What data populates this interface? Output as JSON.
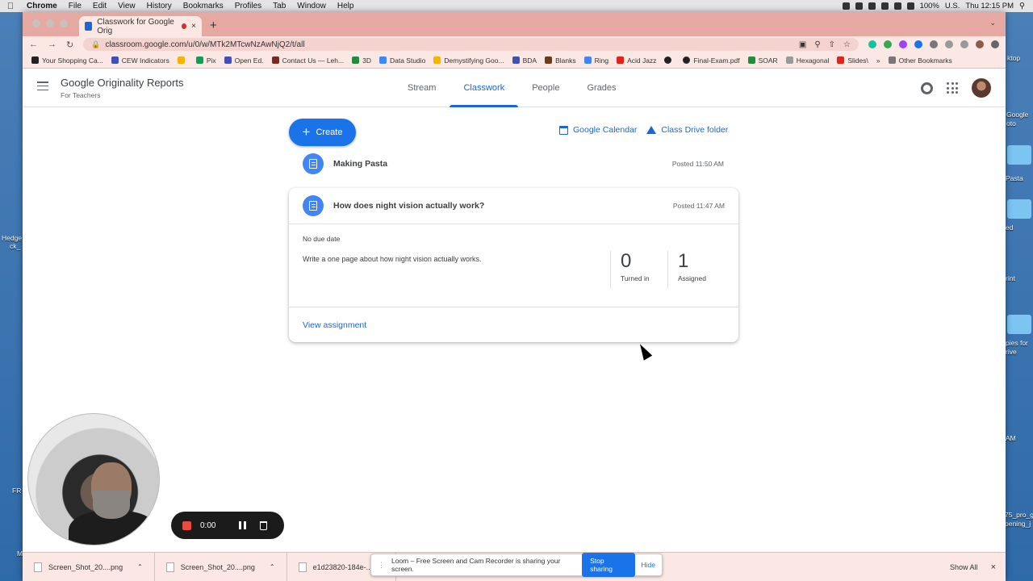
{
  "menubar": {
    "app": "Chrome",
    "items": [
      "File",
      "Edit",
      "View",
      "History",
      "Bookmarks",
      "Profiles",
      "Tab",
      "Window",
      "Help"
    ],
    "battery": "100%",
    "locale": "U.S.",
    "clock": "Thu 12:15 PM"
  },
  "desktop": {
    "labels": [
      "ktop",
      "Google",
      "oto",
      "Pasta",
      "ed",
      "rint",
      "pies for",
      "rive",
      "AM",
      "75_pro_g",
      "pening_j",
      "Hedge",
      "ck_",
      "FR",
      "M"
    ]
  },
  "browser": {
    "tab_title": "Classwork for Google Orig",
    "url": "classroom.google.com/u/0/w/MTk2MTcwNzAwNjQ2/t/all",
    "bookmarks": [
      "Your Shopping Ca...",
      "CEW Indicators",
      "",
      "Pix",
      "Open Ed.",
      "Contact Us — Leh...",
      "3D",
      "Data Studio",
      "Demystifying Goo...",
      "BDA",
      "Blanks",
      "Ring",
      "Acid Jazz",
      "",
      "Final-Exam.pdf",
      "SOAR",
      "Hexagonal",
      "Slides\\"
    ],
    "other_bookmarks": "Other Bookmarks",
    "more": "»"
  },
  "classroom": {
    "course_title": "Google Originality Reports",
    "course_subtitle": "For Teachers",
    "tabs": [
      "Stream",
      "Classwork",
      "People",
      "Grades"
    ],
    "create_label": "Create",
    "calendar_link": "Google Calendar",
    "drive_link": "Class Drive folder",
    "items": [
      {
        "title": "Making Pasta",
        "posted": "Posted 11:50 AM"
      },
      {
        "title": "How does night vision actually work?",
        "posted": "Posted 11:47 AM"
      }
    ],
    "expanded": {
      "due": "No due date",
      "description": "Write a one page about how night vision actually works.",
      "turned_in_count": "0",
      "turned_in_label": "Turned in",
      "assigned_count": "1",
      "assigned_label": "Assigned",
      "view_link": "View assignment"
    }
  },
  "loom": {
    "timer": "0:00",
    "share_message": "Loom – Free Screen and Cam Recorder is sharing your screen.",
    "stop_sharing": "Stop sharing",
    "hide": "Hide"
  },
  "downloads": {
    "files": [
      "Screen_Shot_20....png",
      "Screen_Shot_20....png",
      "e1d23820-184e-....pdf"
    ],
    "show_all": "Show All"
  }
}
